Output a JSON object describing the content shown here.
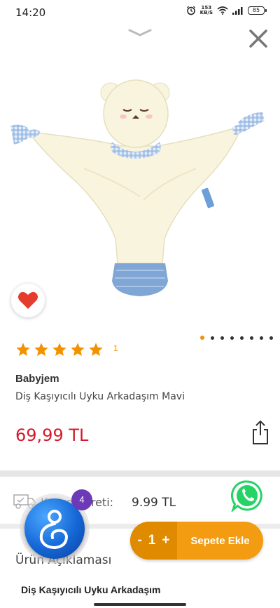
{
  "status_bar": {
    "time": "14:20",
    "net_speed_value": "153",
    "net_speed_unit": "KB/S",
    "battery": "85"
  },
  "product": {
    "rating_count": "1",
    "rating_stars": 5,
    "brand": "Babyjem",
    "name": "Diş Kaşıyıcılı Uyku Arkadaşım Mavi",
    "price": "69,99 TL",
    "carousel_total": 8,
    "carousel_active": 1
  },
  "shipping": {
    "label": "Kargo Ücreti:",
    "value": "9.99 TL"
  },
  "cart": {
    "minus": "-",
    "quantity": "1",
    "plus": "+",
    "add_label": "Sepete Ekle"
  },
  "assistant": {
    "badge": "4"
  },
  "description": {
    "heading": "Ürün Açıklaması",
    "title": "Diş Kaşıyıcılı Uyku Arkadaşım"
  },
  "colors": {
    "accent": "#f39c12",
    "price": "#d6192c",
    "star": "#f39200",
    "whatsapp": "#25d366"
  }
}
